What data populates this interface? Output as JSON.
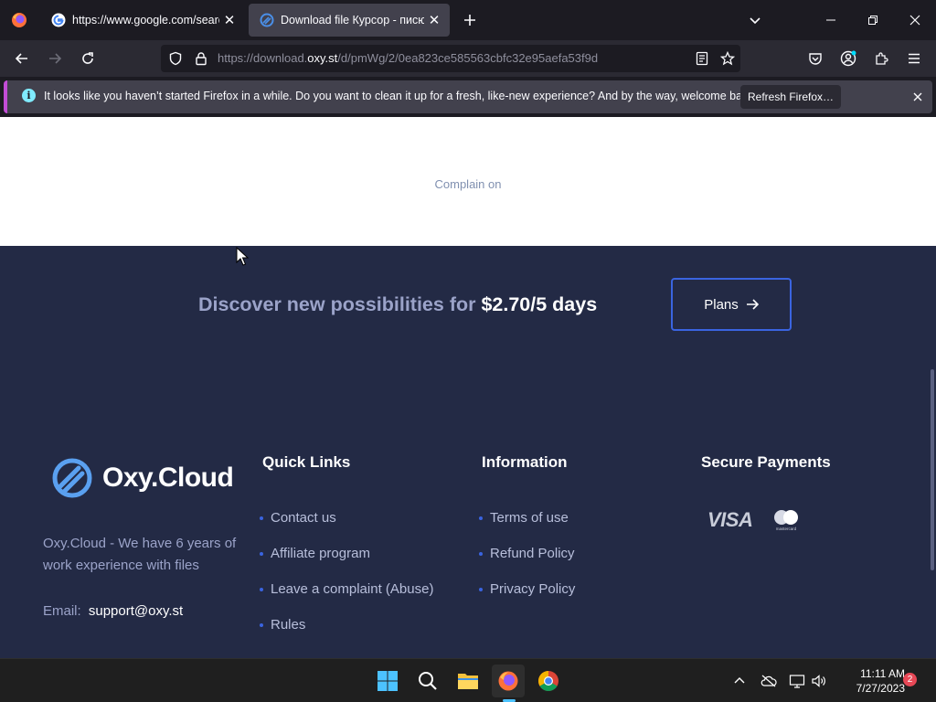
{
  "browser": {
    "tabs": [
      {
        "title": "https://www.google.com/search",
        "favicon": "google-icon"
      },
      {
        "title": "Download file Курсор - писюн",
        "favicon": "oxy-favicon"
      }
    ],
    "url": {
      "prefix": "https://download.",
      "host": "oxy.st",
      "path": "/d/pmWg/2/0ea823ce585563cbfc32e95aefa53f9d"
    },
    "notification": {
      "message": "It looks like you haven’t started Firefox in a while. Do you want to clean it up for a fresh, like-new experience? And by the way, welcome back!",
      "button": "Refresh Firefox…"
    }
  },
  "page": {
    "complain_text": "Complain on",
    "promo": {
      "text": "Discover new possibilities for ",
      "price": "$2.70/5 days",
      "button": "Plans"
    },
    "footer": {
      "brand": "Oxy.Cloud",
      "about": "Oxy.Cloud - We have 6 years of work experience with files",
      "email_label": "Email:",
      "email": "support@oxy.st",
      "quick_links": {
        "heading": "Quick Links",
        "items": [
          "Contact us",
          "Affiliate program",
          "Leave a complaint (Abuse)",
          "Rules"
        ]
      },
      "information": {
        "heading": "Information",
        "items": [
          "Terms of use",
          "Refund Policy",
          "Privacy Policy"
        ]
      },
      "payments": {
        "heading": "Secure Payments",
        "visa": "VISA",
        "mastercard": "mastercard"
      }
    }
  },
  "taskbar": {
    "time": "11:11 AM",
    "date": "7/27/2023",
    "notifications": "2"
  },
  "colors": {
    "accent": "#3a64e0",
    "footer_bg": "#232a45",
    "notification_border": "#c34dd6"
  }
}
